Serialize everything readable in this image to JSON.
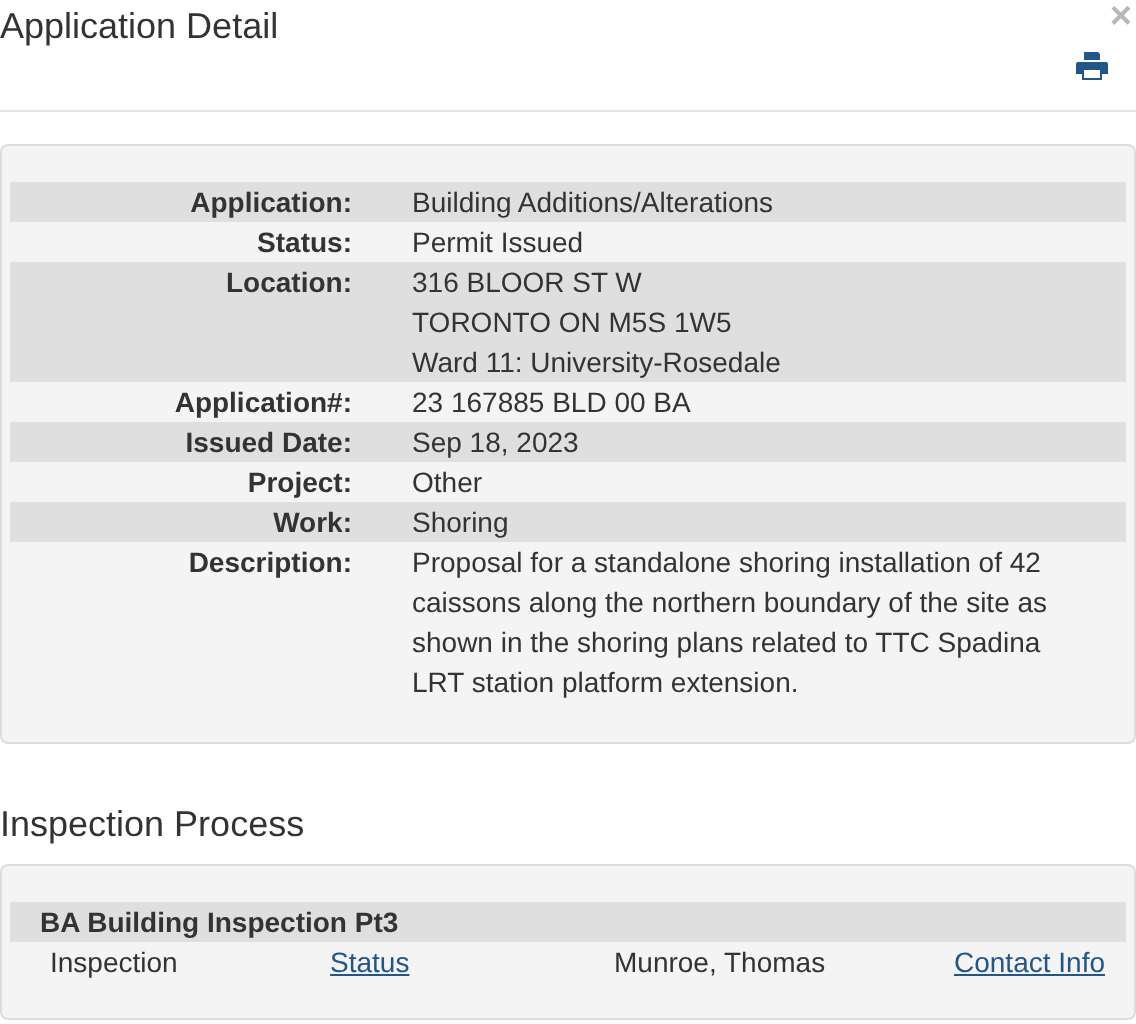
{
  "title": "Application Detail",
  "close": "×",
  "details": [
    {
      "label": "Application:",
      "lines": [
        "Building Additions/Alterations"
      ]
    },
    {
      "label": "Status:",
      "lines": [
        "Permit Issued"
      ]
    },
    {
      "label": "Location:",
      "lines": [
        "316 BLOOR ST W",
        "TORONTO ON M5S 1W5",
        "Ward 11: University-Rosedale"
      ]
    },
    {
      "label": "Application#:",
      "lines": [
        "23 167885 BLD 00 BA"
      ]
    },
    {
      "label": "Issued Date:",
      "lines": [
        "Sep 18, 2023"
      ]
    },
    {
      "label": "Project:",
      "lines": [
        "Other"
      ]
    },
    {
      "label": "Work:",
      "lines": [
        "Shoring"
      ]
    },
    {
      "label": "Description:",
      "lines": [
        "Proposal for a standalone shoring installation of 42 caissons along the northern boundary of the site as shown in the shoring plans related to TTC Spadina LRT station platform extension."
      ]
    }
  ],
  "inspection": {
    "heading": "Inspection Process",
    "group": "BA Building Inspection Pt3",
    "row": {
      "type": "Inspection",
      "status_link": "Status",
      "inspector": "Munroe, Thomas",
      "contact_link": "Contact Info"
    }
  }
}
